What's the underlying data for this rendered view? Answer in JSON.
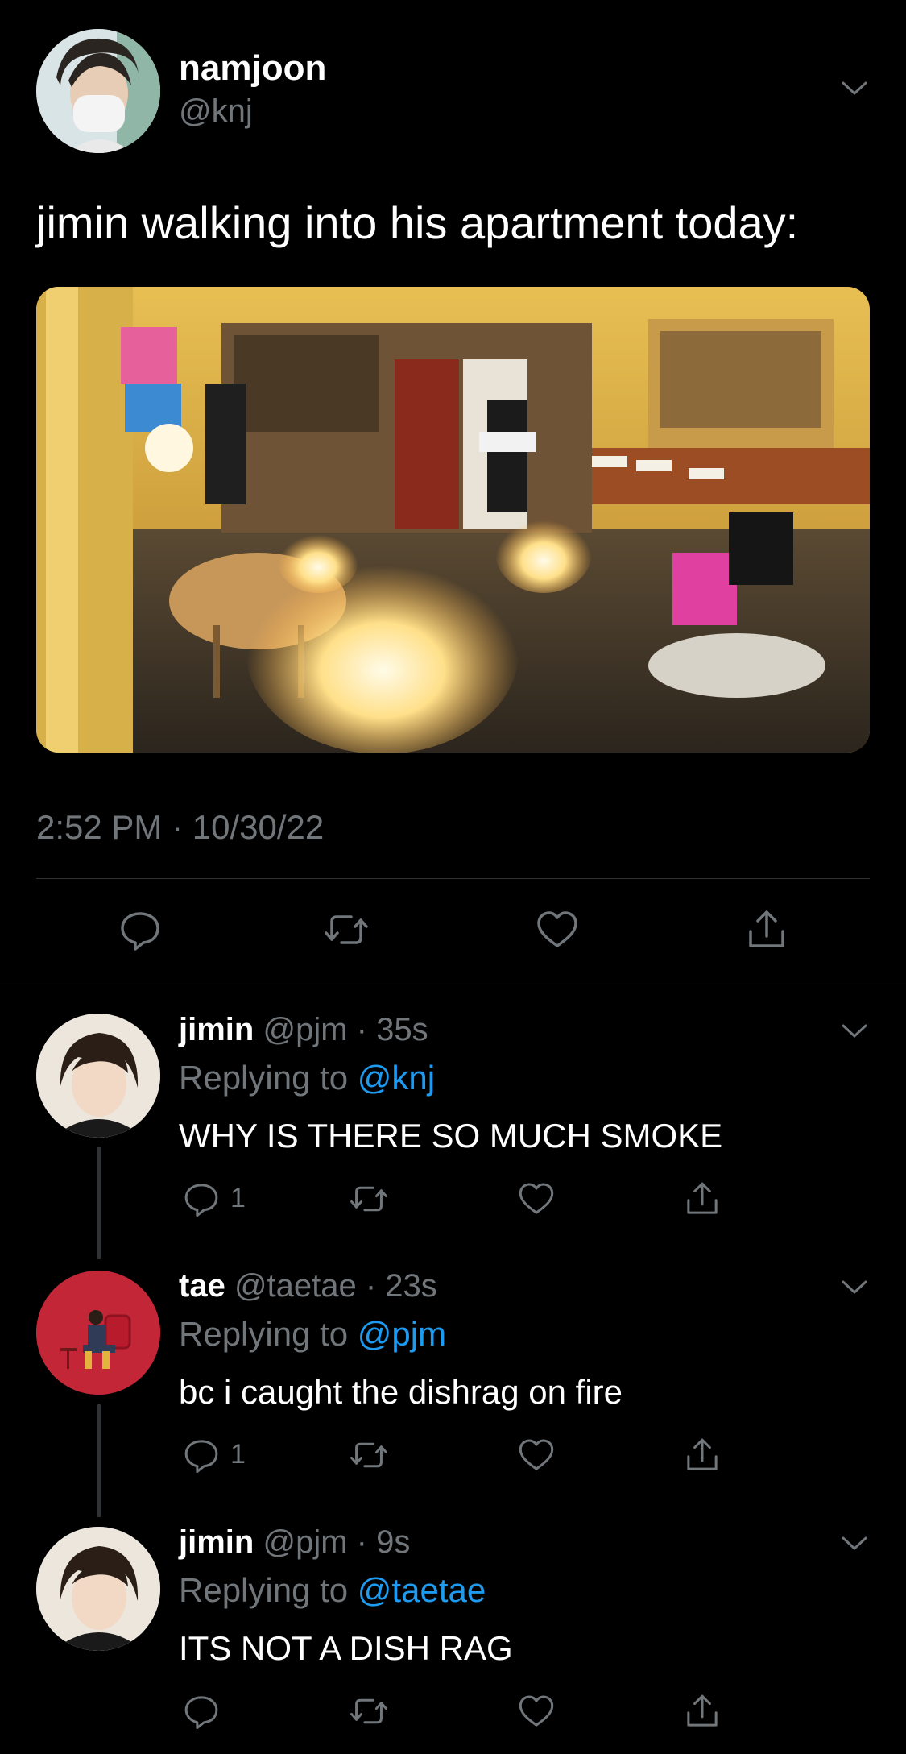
{
  "tweet": {
    "name": "namjoon",
    "handle": "@knj",
    "text": "jimin walking into his apartment today:",
    "timestamp": "2:52 PM · 10/30/22"
  },
  "replies": [
    {
      "name": "jimin",
      "meta": "@pjm · 35s",
      "replying_label": "Replying to",
      "replying_to": "@knj",
      "text": "WHY IS THERE SO MUCH SMOKE",
      "reply_count": "1"
    },
    {
      "name": "tae",
      "meta": "@taetae · 23s",
      "replying_label": "Replying to",
      "replying_to": "@pjm",
      "text": "bc i caught the dishrag on fire",
      "reply_count": "1"
    },
    {
      "name": "jimin",
      "meta": "@pjm · 9s",
      "replying_label": "Replying to",
      "replying_to": "@taetae",
      "text": "ITS NOT A DISH RAG",
      "reply_count": ""
    }
  ],
  "icons": {
    "reply": "reply-icon",
    "retweet": "retweet-icon",
    "like": "heart-icon",
    "share": "share-icon",
    "more": "chevron-down-icon"
  },
  "colors": {
    "background": "#000000",
    "text": "#ffffff",
    "muted": "#71767b",
    "link": "#1d9bf0",
    "divider": "#2f3336"
  }
}
